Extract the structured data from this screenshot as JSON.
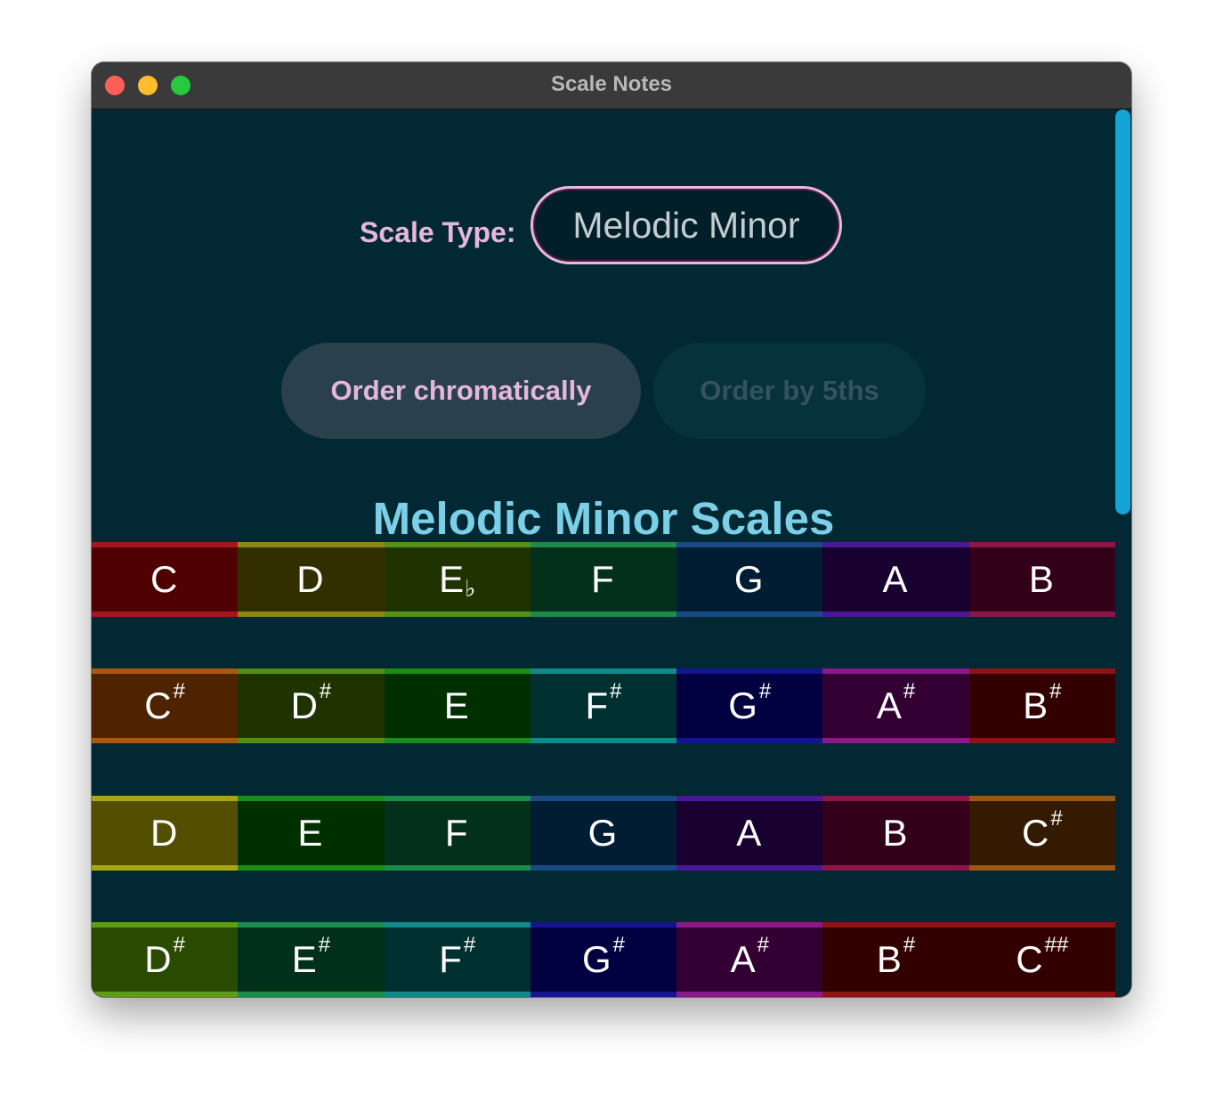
{
  "window": {
    "title": "Scale Notes"
  },
  "controls": {
    "scale_type_label": "Scale Type:",
    "scale_type_value": "Melodic Minor",
    "order_chromatic_label": "Order chromatically",
    "order_fifths_label": "Order by 5ths"
  },
  "heading": "Melodic Minor Scales",
  "colors": {
    "background": "#022933",
    "accent_pink": "#e6b7dc",
    "heading_blue": "#7bd0e8",
    "scrollbar": "#13a5d6"
  },
  "scales": [
    {
      "notes": [
        {
          "letter": "C",
          "accidental": "",
          "fill": "#4f0000",
          "edge": "#a8151f"
        },
        {
          "letter": "D",
          "accidental": "",
          "fill": "#332e00",
          "edge": "#8d8714"
        },
        {
          "letter": "E",
          "accidental": "♭",
          "fill": "#1f3300",
          "edge": "#55901b"
        },
        {
          "letter": "F",
          "accidental": "",
          "fill": "#03301a",
          "edge": "#1d8c4b"
        },
        {
          "letter": "G",
          "accidental": "",
          "fill": "#001d33",
          "edge": "#1a4a86"
        },
        {
          "letter": "A",
          "accidental": "",
          "fill": "#180030",
          "edge": "#4a1796"
        },
        {
          "letter": "B",
          "accidental": "",
          "fill": "#33001a",
          "edge": "#8c1645"
        }
      ]
    },
    {
      "notes": [
        {
          "letter": "C",
          "accidental": "#",
          "fill": "#4d2300",
          "edge": "#a65914"
        },
        {
          "letter": "D",
          "accidental": "#",
          "fill": "#1f3300",
          "edge": "#548c19"
        },
        {
          "letter": "E",
          "accidental": "",
          "fill": "#003000",
          "edge": "#198c19"
        },
        {
          "letter": "F",
          "accidental": "#",
          "fill": "#003030",
          "edge": "#138a8a"
        },
        {
          "letter": "G",
          "accidental": "#",
          "fill": "#000040",
          "edge": "#15158f"
        },
        {
          "letter": "A",
          "accidental": "#",
          "fill": "#330033",
          "edge": "#8a1a8a"
        },
        {
          "letter": "B",
          "accidental": "#",
          "fill": "#330000",
          "edge": "#8c1414"
        }
      ]
    },
    {
      "notes": [
        {
          "letter": "D",
          "accidental": "",
          "fill": "#525000",
          "edge": "#a9a615"
        },
        {
          "letter": "E",
          "accidental": "",
          "fill": "#003000",
          "edge": "#198c19"
        },
        {
          "letter": "F",
          "accidental": "",
          "fill": "#03301a",
          "edge": "#1d8c4b"
        },
        {
          "letter": "G",
          "accidental": "",
          "fill": "#001d33",
          "edge": "#1a4a86"
        },
        {
          "letter": "A",
          "accidental": "",
          "fill": "#180030",
          "edge": "#4a1796"
        },
        {
          "letter": "B",
          "accidental": "",
          "fill": "#33001a",
          "edge": "#8c1645"
        },
        {
          "letter": "C",
          "accidental": "#",
          "fill": "#331a00",
          "edge": "#9c5714"
        }
      ]
    },
    {
      "notes": [
        {
          "letter": "D",
          "accidental": "#",
          "fill": "#2a4a00",
          "edge": "#5e9c1a"
        },
        {
          "letter": "E",
          "accidental": "#",
          "fill": "#003019",
          "edge": "#1a8c4d"
        },
        {
          "letter": "F",
          "accidental": "#",
          "fill": "#003030",
          "edge": "#138a8a"
        },
        {
          "letter": "G",
          "accidental": "#",
          "fill": "#000040",
          "edge": "#15158f"
        },
        {
          "letter": "A",
          "accidental": "#",
          "fill": "#330033",
          "edge": "#8a1a8a"
        },
        {
          "letter": "B",
          "accidental": "#",
          "fill": "#330000",
          "edge": "#8c1414"
        },
        {
          "letter": "C",
          "accidental": "##",
          "fill": "#330000",
          "edge": "#8c1414"
        }
      ]
    }
  ]
}
